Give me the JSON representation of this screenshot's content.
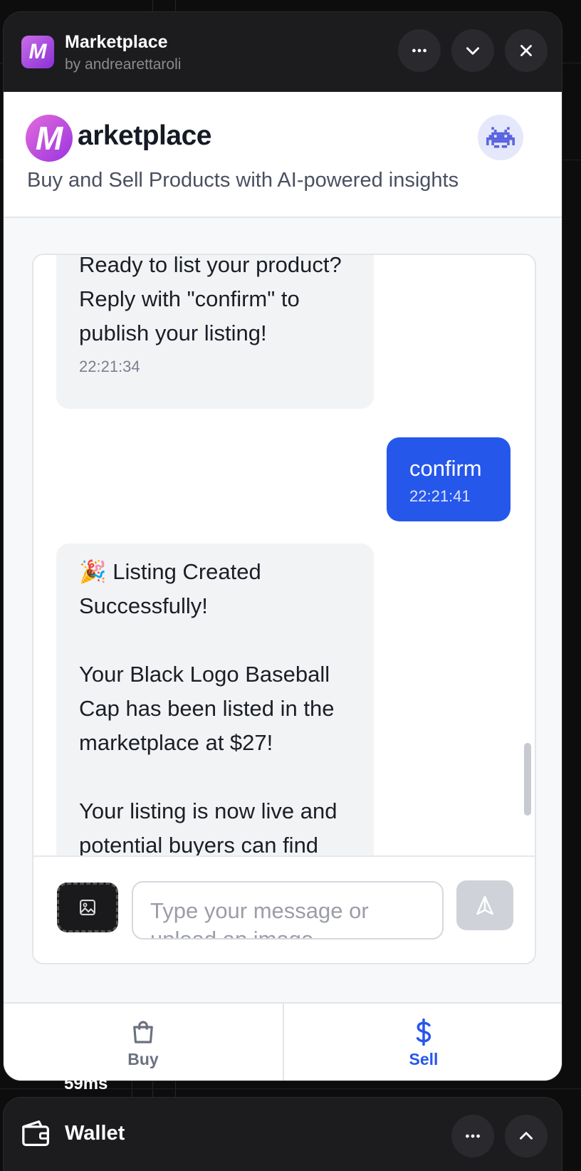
{
  "window": {
    "title": "Marketplace",
    "subtitle": "by andrearettaroli",
    "logo_letter": "M"
  },
  "header": {
    "brand_letter": "M",
    "brand_word": "arketplace",
    "tagline": "Buy and Sell Products with AI-powered insights"
  },
  "messages": [
    {
      "role": "bot",
      "text": "Ready to list your product? Reply with \"confirm\" to publish your listing!",
      "time": "22:21:34"
    },
    {
      "role": "user",
      "text": "confirm",
      "time": "22:21:41"
    },
    {
      "role": "bot",
      "lines": [
        "🎉 Listing Created Successfully!",
        "",
        "Your Black Logo Baseball Cap has been listed in the marketplace at $27!",
        "",
        "Your listing is now live and potential buyers can find"
      ]
    }
  ],
  "composer": {
    "placeholder": "Type your message or upload an image..."
  },
  "tabs": {
    "buy_label": "Buy",
    "sell_label": "Sell",
    "active": "sell"
  },
  "footer": {
    "latency": "59ms",
    "wallet_title": "Wallet"
  },
  "colors": {
    "accent": "#2657eb",
    "brand_gradient_start": "#e36bdc",
    "brand_gradient_end": "#9a34e0",
    "bubble_bot": "#f2f3f5"
  },
  "icons": {
    "titlebar": [
      "more-icon",
      "chevron-down-icon",
      "close-icon"
    ],
    "composer": [
      "image-icon",
      "send-icon"
    ],
    "tabs": [
      "shopping-bag-icon",
      "dollar-icon"
    ],
    "wallet": [
      "wallet-icon",
      "more-icon",
      "chevron-up-icon"
    ]
  }
}
